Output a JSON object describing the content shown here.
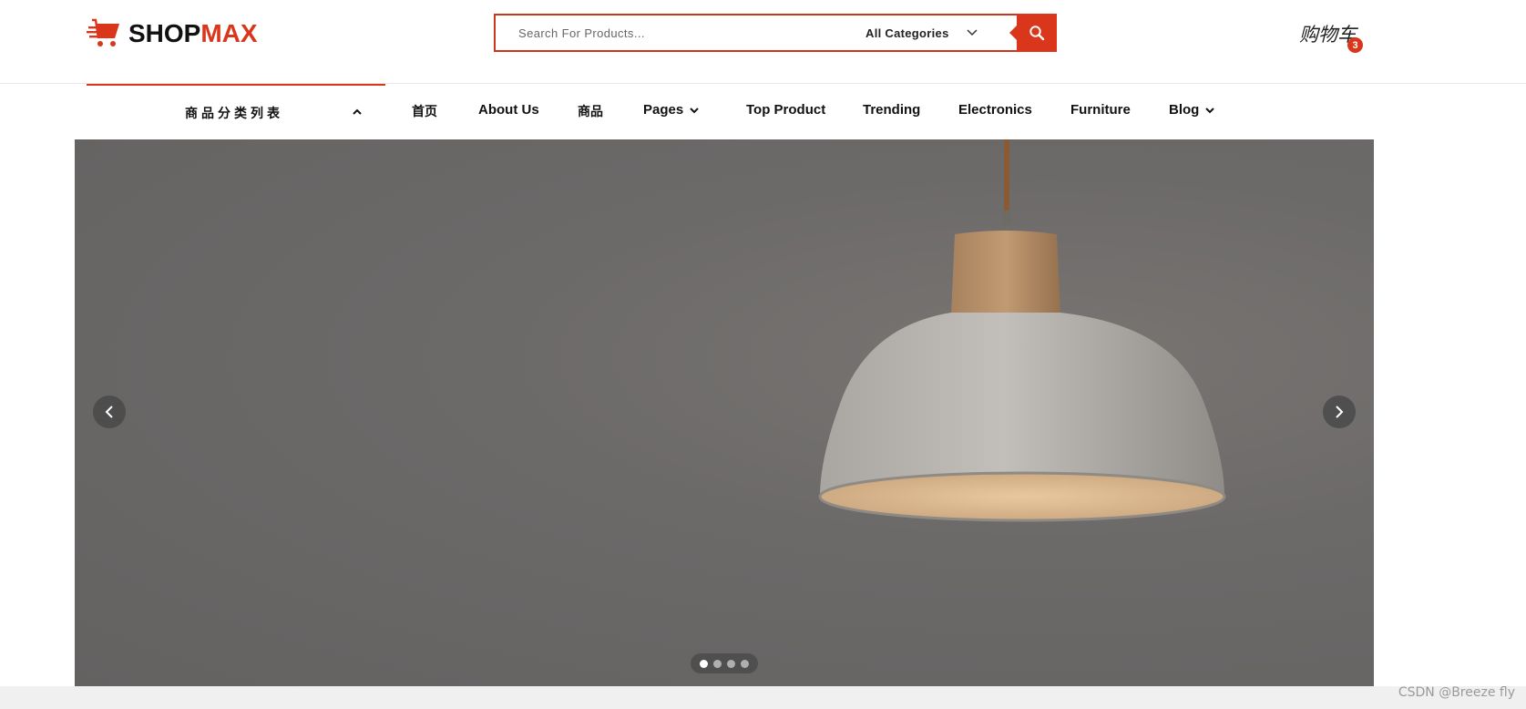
{
  "header": {
    "logo": {
      "part1": "SHOP",
      "part2": "MAX"
    },
    "search": {
      "placeholder": "Search For Products...",
      "category": "All Categories"
    },
    "cart": {
      "label": "购物车",
      "count": "3"
    }
  },
  "nav": {
    "category_menu": "商品分类列表",
    "items": [
      {
        "label": "首页"
      },
      {
        "label": "About Us"
      },
      {
        "label": "商品"
      },
      {
        "label": "Pages"
      },
      {
        "label": "Top Product"
      },
      {
        "label": "Trending"
      },
      {
        "label": "Electronics"
      },
      {
        "label": "Furniture"
      },
      {
        "label": "Blog"
      }
    ]
  },
  "hero": {
    "slides_total": 4,
    "active_slide": 1
  },
  "footer": {
    "watermark": "CSDN @Breeze fly"
  },
  "colors": {
    "accent": "#d9361b",
    "hero_bg": "#6b6968"
  }
}
